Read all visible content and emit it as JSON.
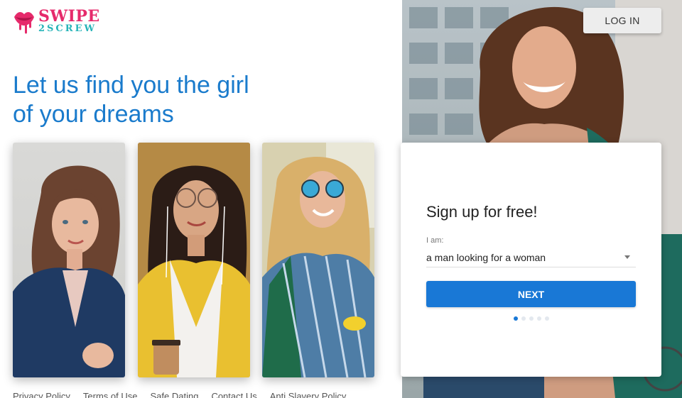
{
  "brand": {
    "line1": "SWIPE",
    "line2": "2SCREW",
    "colors": {
      "pink": "#e62a6b",
      "teal": "#27b4b8"
    }
  },
  "header": {
    "login_label": "LOG IN"
  },
  "hero": {
    "headline_line1": "Let us find you the girl",
    "headline_line2": "of your dreams",
    "headline_color": "#1a7bcc"
  },
  "photos": [
    {
      "description": "woman in navy blazer"
    },
    {
      "description": "woman with glasses holding coffee"
    },
    {
      "description": "woman with sunglasses and backpack"
    }
  ],
  "signup": {
    "title": "Sign up for free!",
    "field_label": "I am:",
    "selected_value": "a man looking for a woman",
    "next_label": "NEXT",
    "step_count": 5,
    "current_step": 1,
    "accent": "#1978d6"
  },
  "footer": {
    "links": [
      "Privacy Policy",
      "Terms of Use",
      "Safe Dating",
      "Contact Us",
      "Anti Slavery Policy"
    ]
  }
}
